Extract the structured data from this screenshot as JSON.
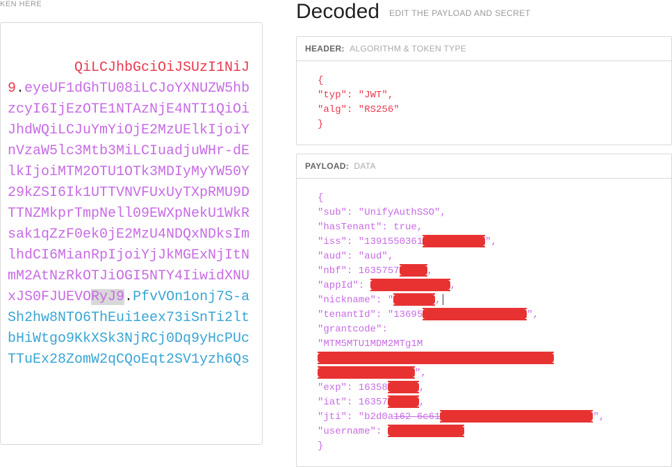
{
  "left": {
    "hint": "KEN HERE",
    "token_header": "QiLCJhbGciOiJSUzI1NiJ9",
    "token_payload_part1": "eyeUF1dGhTU08iLCJoYXNUZW5hbzcyI6IjEzOTE1NTAzNjE4NTI1QiOiJhdWQiLCJuYmYiOjE2MzUElkIjoiYnVzaW5lc3Mtb3MiLCIuadjuWHr-dElkIjoiMTM2OTU1OTk3MDIyMyYW50Y29kZSI6Ik1UTTVNVFUxUyTXpRMU9DTTNZMkprTmpNell09EWXpNekU1WkRsak1qZzF0ek0jE2MzU4NDQxNDksImlhdCI6MianRpIjoiYjJkMGExNjItNmM2AtNzRkOTJiOGI5NTY4IiwidXNUxJS0FJUEVO",
    "token_payload_highlight": "RyJ9",
    "token_sig": "PfvVOn1onj7S-aSh2hw8NTO6ThEui1eex73iSnTi2ltbHiWtgo9KkXSk3NjRCj0Dq9yHcPUcTTuEx28ZomW2qCQoEqt2SV1yzh6Qs"
  },
  "right": {
    "title": "Decoded",
    "subtitle": "EDIT THE PAYLOAD AND SECRET",
    "header_section": {
      "label": "HEADER:",
      "sublabel": "ALGORITHM & TOKEN TYPE",
      "json_lines": [
        "{",
        "  \"typ\": \"JWT\",",
        "  \"alg\": \"RS256\"",
        "}"
      ]
    },
    "payload_section": {
      "label": "PAYLOAD:",
      "sublabel": "DATA",
      "lines": {
        "open": "{",
        "sub": "  \"sub\": \"UnifyAuthSSO\",",
        "hasTenant": "  \"hasTenant\": true,",
        "iss_pre": "  \"iss\": \"1391550361",
        "iss_post": "\",",
        "aud": "  \"aud\": \"aud\",",
        "nbf_pre": "  \"nbf\": 16357",
        "nbf_post": ",",
        "appId_pre": "  \"appId\": ",
        "appId_post": ",",
        "nickname_pre": "  \"nickname\": \"",
        "nickname_post": ",",
        "tenantId_pre": "  \"tenantId\": \"13695",
        "tenantId_post": "\",",
        "grantcode": "  \"grantcode\":",
        "gc_line1_pre": "\"MTM5MTU1MDM2MTg1M",
        "gc_line2_post": "\",",
        "exp_pre": "  \"exp\": 16358",
        "exp_post": ",",
        "iat_pre": "  \"iat\": 16357",
        "iat_post": ",",
        "jti_pre": "  \"jti\": \"b2d0a",
        "jti_mid": "162-6c61",
        "jti_post": "\",",
        "username_pre": "  \"username\": ",
        "close": "}"
      }
    }
  }
}
